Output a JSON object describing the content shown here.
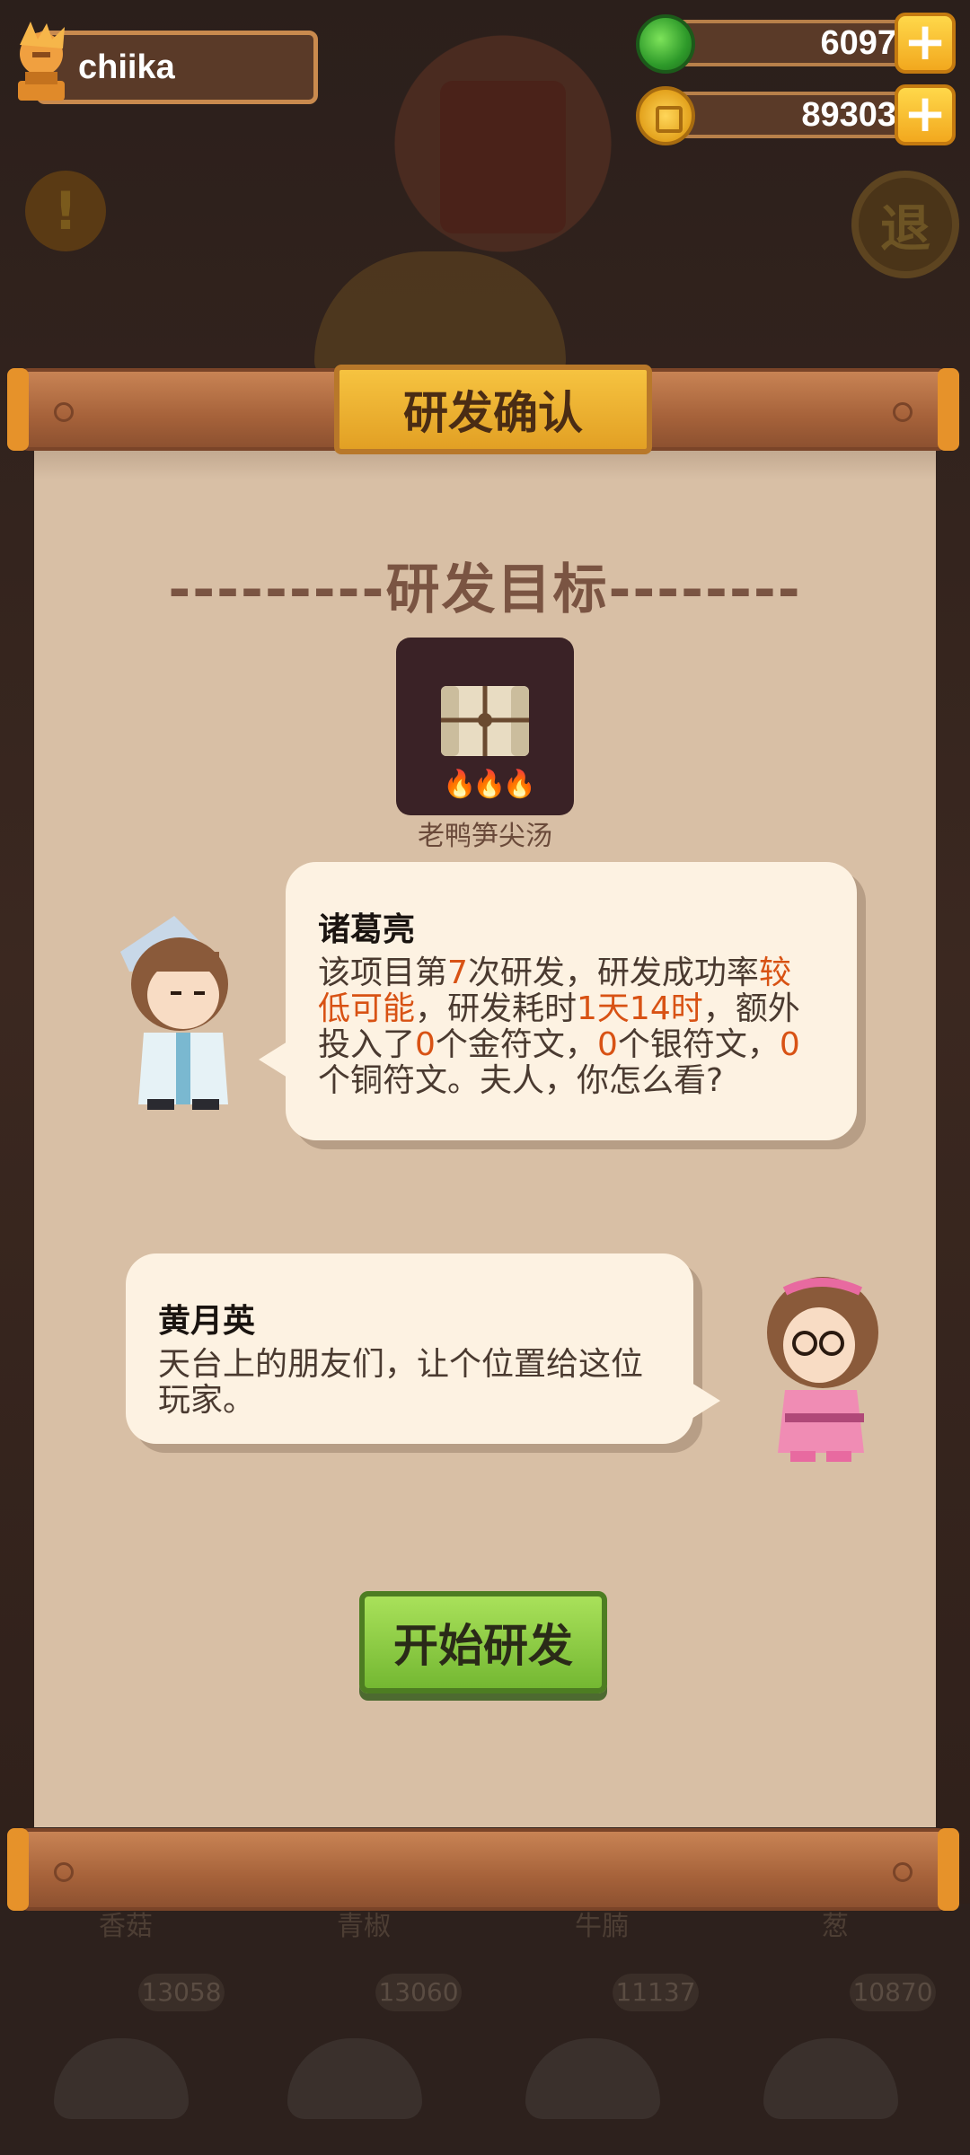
{
  "player": {
    "name": "chiika"
  },
  "resources": {
    "jade": {
      "value": "6097",
      "icon": "jade-orb-icon"
    },
    "coins": {
      "value": "89303",
      "icon": "copper-coin-icon"
    }
  },
  "background": {
    "back_label": "退",
    "bottom_items": [
      "香菇",
      "青椒",
      "牛腩",
      "葱"
    ],
    "bottom_counts": [
      "13058",
      "13060",
      "11137",
      "10870"
    ]
  },
  "dialog": {
    "title": "研发确认",
    "section_heading": "---------研发目标--------",
    "target_item": {
      "name": "老鸭笋尖汤",
      "flames": "🔥🔥🔥"
    },
    "advisor": {
      "name": "诸葛亮",
      "text_parts": {
        "p1": "该项目第",
        "n1": "7",
        "p2": "次研发，研发成功率",
        "h1": "较低可能",
        "p3": "，研发耗时",
        "h2": "1天14时",
        "p4": "，额外投入了",
        "n2": "0",
        "p5": "个金符文，",
        "n3": "0",
        "p6": "个银符文，",
        "n4": "0",
        "p7": "个铜符文。夫人，你怎么看?"
      }
    },
    "wife": {
      "name": "黄月英",
      "text": "天台上的朋友们，让个位置给这位玩家。"
    },
    "start_button": "开始研发"
  },
  "colors": {
    "highlight": "#d85214",
    "button_green": "#8ccc44",
    "plaque_gold": "#f0b432"
  }
}
